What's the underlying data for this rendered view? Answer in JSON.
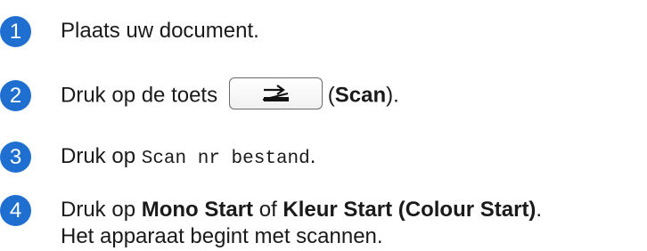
{
  "steps": [
    {
      "number": "1",
      "text": "Plaats uw document."
    },
    {
      "number": "2",
      "text_before": "Druk op de toets",
      "text_after_open": "(",
      "bold": "Scan",
      "text_after_close": ")."
    },
    {
      "number": "3",
      "text_before": "Druk op",
      "mono": "Scan nr bestand",
      "text_after": "."
    },
    {
      "number": "4",
      "text_before": "Druk op",
      "bold1": "Mono Start",
      "mid": "of",
      "bold2": "Kleur Start (Colour Start)",
      "text_after": ".",
      "line2": "Het apparaat begint met scannen."
    }
  ],
  "colors": {
    "badge": "#1f6fd1",
    "text": "#1a1a1a"
  },
  "icons": {
    "scan_button": "scan-icon"
  }
}
